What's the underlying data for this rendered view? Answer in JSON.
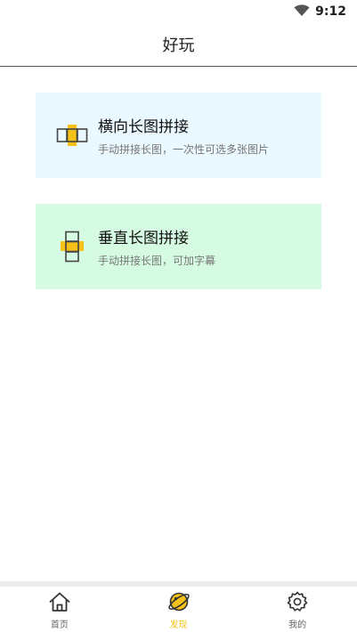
{
  "status": {
    "time": "9:12",
    "wifi_icon": "wifi-icon"
  },
  "app_bar": {
    "title": "好玩"
  },
  "cards": [
    {
      "title": "横向长图拼接",
      "subtitle": "手动拼接长图，一次性可选多张图片",
      "icon": "horizontal-stitch-icon",
      "bg": "#eaf8ff"
    },
    {
      "title": "垂直长图拼接",
      "subtitle": "手动拼接长图，可加字幕",
      "icon": "vertical-stitch-icon",
      "bg": "#d6fbe3"
    }
  ],
  "tabs": [
    {
      "label": "首页",
      "icon": "home-icon",
      "active": false
    },
    {
      "label": "发现",
      "icon": "planet-icon",
      "active": true
    },
    {
      "label": "我的",
      "icon": "gear-icon",
      "active": false
    }
  ],
  "colors": {
    "accent": "#f2c21b",
    "divider": "#555555"
  }
}
